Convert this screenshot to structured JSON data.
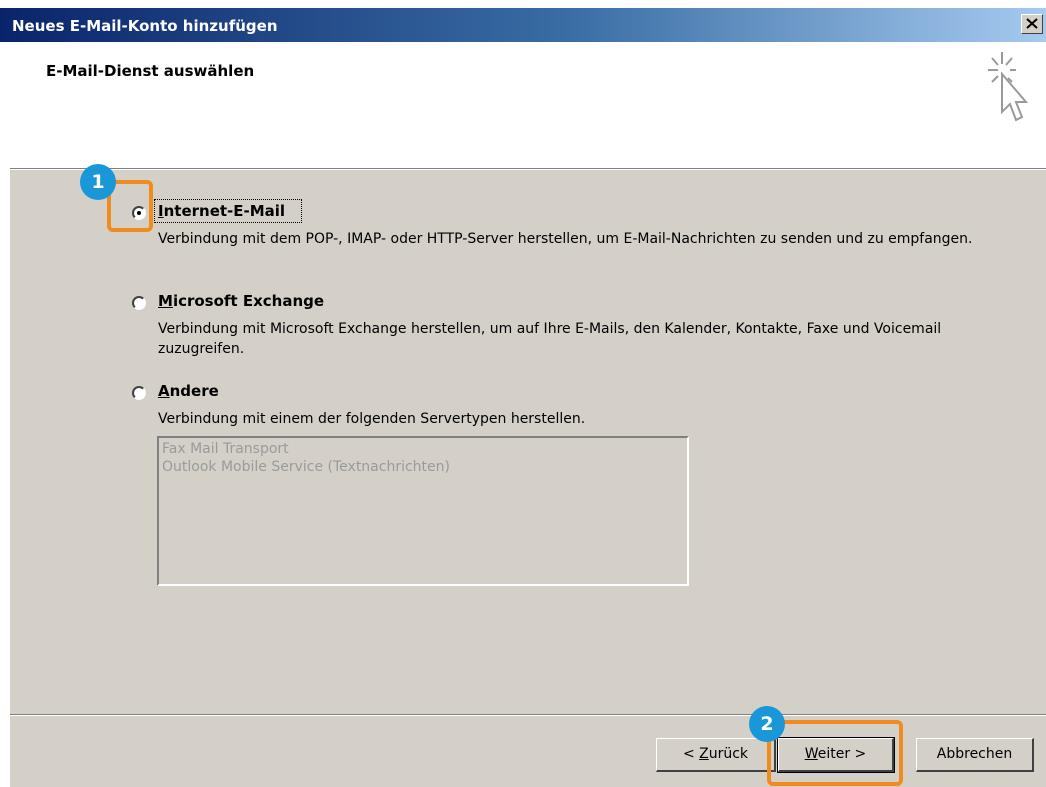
{
  "window": {
    "title": "Neues E-Mail-Konto hinzufügen",
    "close_symbol": "×"
  },
  "header": {
    "title": "E-Mail-Dienst auswählen",
    "icon": "cursor-sparkle-icon"
  },
  "options": [
    {
      "label_accel": "I",
      "label_rest": "nternet-E-Mail",
      "description": "Verbindung mit dem POP-, IMAP- oder HTTP-Server herstellen, um E-Mail-Nachrichten zu senden und zu empfangen.",
      "selected": true
    },
    {
      "label_accel": "M",
      "label_rest": "icrosoft Exchange",
      "description": "Verbindung mit Microsoft Exchange herstellen, um auf Ihre E-Mails, den Kalender, Kontakte, Faxe und Voicemail zuzugreifen.",
      "selected": false
    },
    {
      "label_accel": "A",
      "label_rest": "ndere",
      "description": "Verbindung mit einem der folgenden Servertypen herstellen.",
      "selected": false
    }
  ],
  "server_list": {
    "items": [
      "Fax Mail Transport",
      "Outlook Mobile Service (Textnachrichten)"
    ]
  },
  "buttons": {
    "back_pre": "< ",
    "back_accel": "Z",
    "back_rest": "urück",
    "next_accel": "W",
    "next_rest": "eiter >",
    "cancel": "Abbrechen"
  },
  "annotations": {
    "step1": "1",
    "step2": "2",
    "highlight_color": "#f08c1e",
    "badge_color": "#1a97d9"
  }
}
